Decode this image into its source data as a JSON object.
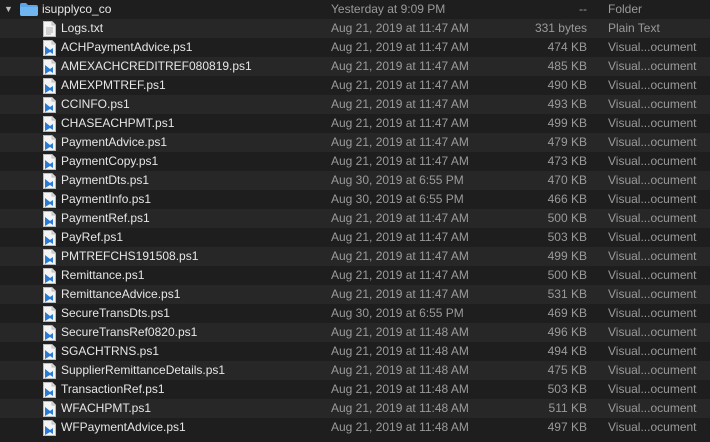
{
  "folder": {
    "name": "isupplyco_co",
    "date": "Yesterday at 9:09 PM",
    "size": "--",
    "kind": "Folder",
    "icon": "folder-icon",
    "color": "#5aa6e6"
  },
  "files": [
    {
      "name": "Logs.txt",
      "date": "Aug 21, 2019 at 11:47 AM",
      "size": "331 bytes",
      "kind": "Plain Text",
      "icon": "text-file-icon"
    },
    {
      "name": "ACHPaymentAdvice.ps1",
      "date": "Aug 21, 2019 at 11:47 AM",
      "size": "474 KB",
      "kind": "Visual...ocument",
      "icon": "script-file-icon"
    },
    {
      "name": "AMEXACHCREDITREF080819.ps1",
      "date": "Aug 21, 2019 at 11:47 AM",
      "size": "485 KB",
      "kind": "Visual...ocument",
      "icon": "script-file-icon"
    },
    {
      "name": "AMEXPMTREF.ps1",
      "date": "Aug 21, 2019 at 11:47 AM",
      "size": "490 KB",
      "kind": "Visual...ocument",
      "icon": "script-file-icon"
    },
    {
      "name": "CCINFO.ps1",
      "date": "Aug 21, 2019 at 11:47 AM",
      "size": "493 KB",
      "kind": "Visual...ocument",
      "icon": "script-file-icon"
    },
    {
      "name": "CHASEACHPMT.ps1",
      "date": "Aug 21, 2019 at 11:47 AM",
      "size": "499 KB",
      "kind": "Visual...ocument",
      "icon": "script-file-icon"
    },
    {
      "name": "PaymentAdvice.ps1",
      "date": "Aug 21, 2019 at 11:47 AM",
      "size": "479 KB",
      "kind": "Visual...ocument",
      "icon": "script-file-icon"
    },
    {
      "name": "PaymentCopy.ps1",
      "date": "Aug 21, 2019 at 11:47 AM",
      "size": "473 KB",
      "kind": "Visual...ocument",
      "icon": "script-file-icon"
    },
    {
      "name": "PaymentDts.ps1",
      "date": "Aug 30, 2019 at 6:55 PM",
      "size": "470 KB",
      "kind": "Visual...ocument",
      "icon": "script-file-icon"
    },
    {
      "name": "PaymentInfo.ps1",
      "date": "Aug 30, 2019 at 6:55 PM",
      "size": "466 KB",
      "kind": "Visual...ocument",
      "icon": "script-file-icon"
    },
    {
      "name": "PaymentRef.ps1",
      "date": "Aug 21, 2019 at 11:47 AM",
      "size": "500 KB",
      "kind": "Visual...ocument",
      "icon": "script-file-icon"
    },
    {
      "name": "PayRef.ps1",
      "date": "Aug 21, 2019 at 11:47 AM",
      "size": "503 KB",
      "kind": "Visual...ocument",
      "icon": "script-file-icon"
    },
    {
      "name": "PMTREFCHS191508.ps1",
      "date": "Aug 21, 2019 at 11:47 AM",
      "size": "499 KB",
      "kind": "Visual...ocument",
      "icon": "script-file-icon"
    },
    {
      "name": "Remittance.ps1",
      "date": "Aug 21, 2019 at 11:47 AM",
      "size": "500 KB",
      "kind": "Visual...ocument",
      "icon": "script-file-icon"
    },
    {
      "name": "RemittanceAdvice.ps1",
      "date": "Aug 21, 2019 at 11:47 AM",
      "size": "531 KB",
      "kind": "Visual...ocument",
      "icon": "script-file-icon"
    },
    {
      "name": "SecureTransDts.ps1",
      "date": "Aug 30, 2019 at 6:55 PM",
      "size": "469 KB",
      "kind": "Visual...ocument",
      "icon": "script-file-icon"
    },
    {
      "name": "SecureTransRef0820.ps1",
      "date": "Aug 21, 2019 at 11:48 AM",
      "size": "496 KB",
      "kind": "Visual...ocument",
      "icon": "script-file-icon"
    },
    {
      "name": "SGACHTRNS.ps1",
      "date": "Aug 21, 2019 at 11:48 AM",
      "size": "494 KB",
      "kind": "Visual...ocument",
      "icon": "script-file-icon"
    },
    {
      "name": "SupplierRemittanceDetails.ps1",
      "date": "Aug 21, 2019 at 11:48 AM",
      "size": "475 KB",
      "kind": "Visual...ocument",
      "icon": "script-file-icon"
    },
    {
      "name": "TransactionRef.ps1",
      "date": "Aug 21, 2019 at 11:48 AM",
      "size": "503 KB",
      "kind": "Visual...ocument",
      "icon": "script-file-icon"
    },
    {
      "name": "WFACHPMT.ps1",
      "date": "Aug 21, 2019 at 11:48 AM",
      "size": "511 KB",
      "kind": "Visual...ocument",
      "icon": "script-file-icon"
    },
    {
      "name": "WFPaymentAdvice.ps1",
      "date": "Aug 21, 2019 at 11:48 AM",
      "size": "497 KB",
      "kind": "Visual...ocument",
      "icon": "script-file-icon"
    }
  ],
  "colors": {
    "background": "#1e1e1e",
    "alt_row": "#272727",
    "script_icon_blue": "#2a7bd4"
  }
}
